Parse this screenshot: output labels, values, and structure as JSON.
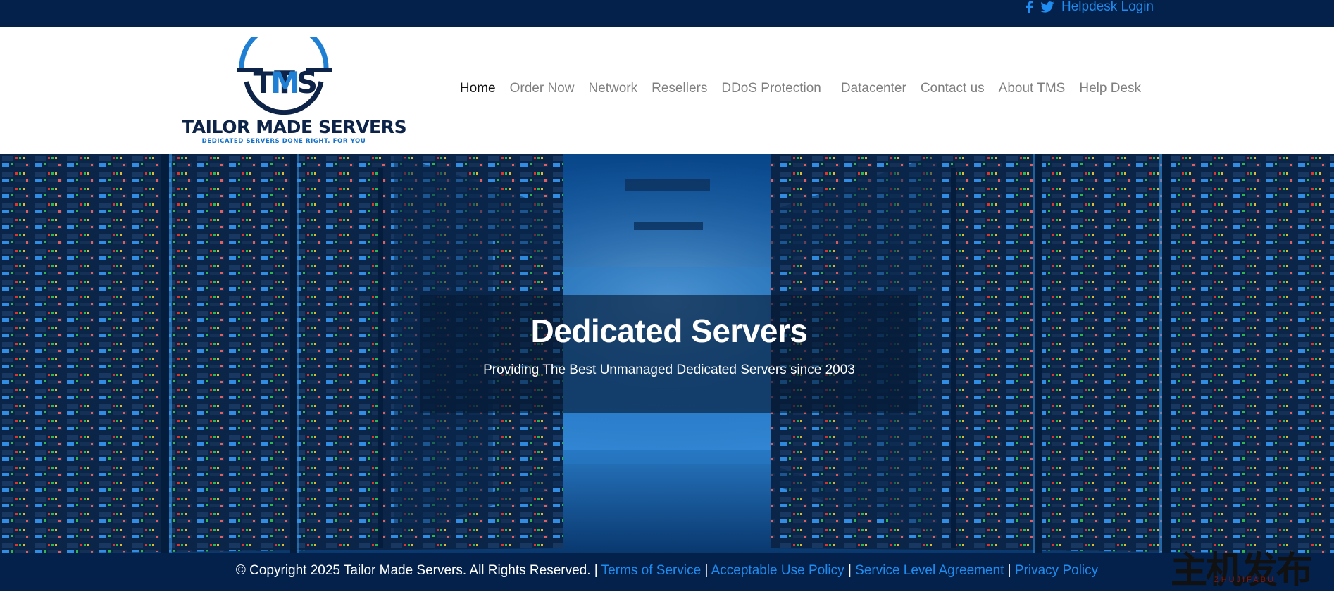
{
  "topbar": {
    "facebook_icon": "facebook-icon",
    "twitter_icon": "twitter-icon",
    "helpdesk_login": "Helpdesk Login"
  },
  "logo": {
    "monogram": "TMS",
    "wordmark": "TAILOR MADE SERVERS",
    "tagline": "DEDICATED SERVERS DONE RIGHT. FOR YOU"
  },
  "nav": {
    "items": [
      {
        "label": "Home",
        "active": true
      },
      {
        "label": "Order Now"
      },
      {
        "label": "Network"
      },
      {
        "label": "Resellers"
      },
      {
        "label": "DDoS Protection"
      },
      {
        "label": "Datacenter"
      },
      {
        "label": "Contact us"
      },
      {
        "label": "About TMS"
      },
      {
        "label": "Help Desk"
      }
    ]
  },
  "hero": {
    "title": "Dedicated Servers",
    "subtitle": "Providing The Best Unmanaged Dedicated Servers since 2003"
  },
  "footer": {
    "copyright": "© Copyright 2025 Tailor Made Servers. All Rights Reserved. |",
    "links": [
      "Terms of Service",
      "Acceptable Use Policy",
      "Service Level Agreement",
      "Privacy Policy"
    ],
    "separator": "|"
  },
  "watermark": {
    "main": "主机发布",
    "small": "ZHUJIFABU"
  },
  "colors": {
    "navy": "#03214a",
    "link_blue": "#1e8cf0",
    "nav_gray": "#7f7f7f"
  }
}
